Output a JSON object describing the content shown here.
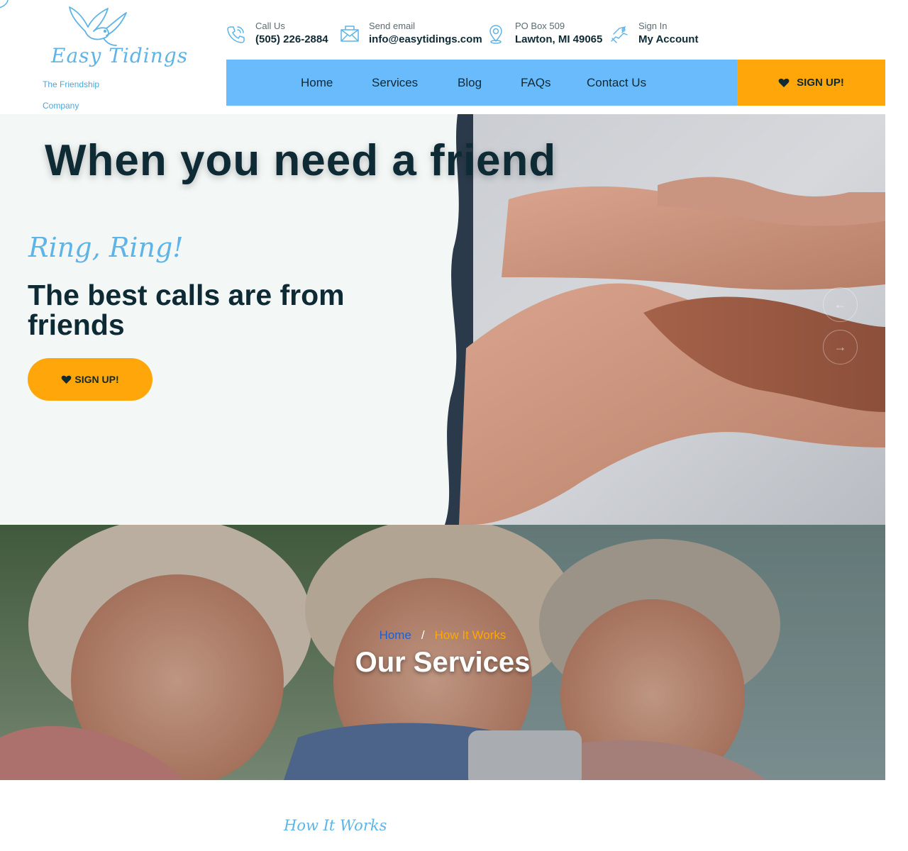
{
  "header": {
    "logo_text": "Easy Tidings",
    "tagline": "The Friendship Company",
    "contacts": [
      {
        "icon": "phone-icon",
        "label": "Call Us",
        "value": "(505) 226-2884"
      },
      {
        "icon": "envelope-icon",
        "label": "Send email",
        "value": "info@easytidings.com"
      },
      {
        "icon": "location-pin-icon",
        "label": "PO Box 509",
        "value": "Lawton, MI 49065"
      },
      {
        "icon": "account-icon",
        "label": "Sign In",
        "value": "My Account"
      }
    ]
  },
  "nav": {
    "items": [
      "Home",
      "Services",
      "Blog",
      "FAQs",
      "Contact Us"
    ],
    "signup": "SIGN UP!"
  },
  "hero": {
    "title": "When you need a friend",
    "kicker": "Ring, Ring!",
    "subtitle": "The best calls are from friends",
    "button": "SIGN UP!",
    "prev_arrow": "←",
    "next_arrow": "→"
  },
  "banner": {
    "breadcrumb_home": "Home",
    "breadcrumb_sep": "/",
    "breadcrumb_current": "How It Works",
    "title": "Our Services"
  },
  "section": {
    "kicker": "How It Works"
  },
  "colors": {
    "nav_blue": "#69bbfc",
    "accent_orange": "#fea60a",
    "dark_text": "#0e2a35",
    "script_blue": "#5eb4e6",
    "hero_bg": "#f3f7f6"
  }
}
